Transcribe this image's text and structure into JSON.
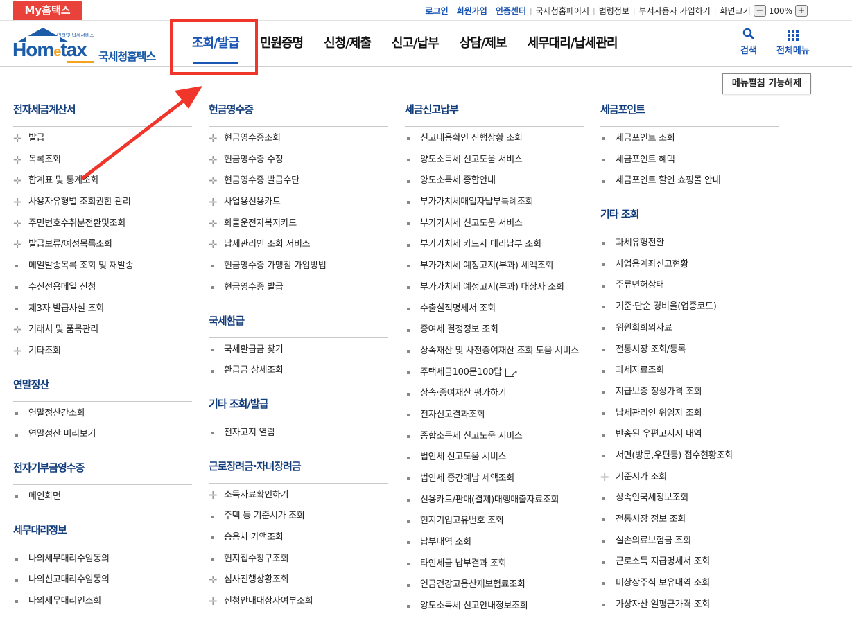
{
  "top": {
    "myhometax": "My홈택스",
    "links": [
      "로그인",
      "회원가입",
      "인증센터"
    ],
    "links2": [
      "국세청홈페이지",
      "법령정보",
      "부서사용자 가입하기",
      "화면크기"
    ],
    "zoom_value": "100%",
    "zoom_minus": "−",
    "zoom_plus": "+"
  },
  "header": {
    "logo_small": "인터넷 납세서비스",
    "logo_home": "Hom",
    "logo_e": "e",
    "logo_tax": "tax",
    "logo_kr": "국세청홈택스",
    "nav": [
      "조회/발급",
      "민원증명",
      "신청/제출",
      "신고/납부",
      "상담/제보",
      "세무대리/납세관리"
    ],
    "search_label": "검색",
    "allmenu_label": "전체메뉴"
  },
  "menu_toggle_label": "메뉴펼침 기능해제",
  "columns": [
    {
      "sections": [
        {
          "title": "전자세금계산서",
          "items": [
            {
              "b": "plus",
              "t": "발급"
            },
            {
              "b": "plus",
              "t": "목록조회"
            },
            {
              "b": "plus",
              "t": "합계표 및 통계조회"
            },
            {
              "b": "plus",
              "t": "사용자유형별 조회권한 관리"
            },
            {
              "b": "plus",
              "t": "주민번호수취분전환및조회"
            },
            {
              "b": "plus",
              "t": "발급보류/예정목록조회"
            },
            {
              "b": "dot",
              "t": "메일발송목록 조회 및 재발송"
            },
            {
              "b": "dot",
              "t": "수신전용메일 신청"
            },
            {
              "b": "dot",
              "t": "제3자 발급사실 조회"
            },
            {
              "b": "plus",
              "t": "거래처 및 품목관리"
            },
            {
              "b": "plus",
              "t": "기타조회"
            }
          ]
        },
        {
          "title": "연말정산",
          "items": [
            {
              "b": "dot",
              "t": "연말정산간소화"
            },
            {
              "b": "dot",
              "t": "연말정산 미리보기"
            }
          ]
        },
        {
          "title": "전자기부금영수증",
          "items": [
            {
              "b": "dot",
              "t": "메인화면"
            }
          ]
        },
        {
          "title": "세무대리정보",
          "items": [
            {
              "b": "dot",
              "t": "나의세무대리수임동의"
            },
            {
              "b": "dot",
              "t": "나의신고대리수임동의"
            },
            {
              "b": "dot",
              "t": "나의세무대리인조회"
            }
          ]
        }
      ]
    },
    {
      "sections": [
        {
          "title": "현금영수증",
          "items": [
            {
              "b": "plus",
              "t": "현금영수증조회"
            },
            {
              "b": "plus",
              "t": "현금영수증 수정"
            },
            {
              "b": "plus",
              "t": "현금영수증 발급수단"
            },
            {
              "b": "plus",
              "t": "사업용신용카드"
            },
            {
              "b": "plus",
              "t": "화물운전자복지카드"
            },
            {
              "b": "plus",
              "t": "납세관리인 조회 서비스"
            },
            {
              "b": "dot",
              "t": "현금영수증 가맹점 가입방법"
            },
            {
              "b": "dot",
              "t": "현금영수증 발급"
            }
          ]
        },
        {
          "title": "국세환급",
          "items": [
            {
              "b": "dot",
              "t": "국세환급금 찾기"
            },
            {
              "b": "dot",
              "t": "환급금 상세조회"
            }
          ]
        },
        {
          "title": "기타 조회/발급",
          "items": [
            {
              "b": "dot",
              "t": "전자고지 열람"
            }
          ]
        },
        {
          "title": "근로장려금·자녀장려금",
          "items": [
            {
              "b": "plus",
              "t": "소득자료확인하기"
            },
            {
              "b": "dot",
              "t": "주택 등 기준시가 조회"
            },
            {
              "b": "dot",
              "t": "승용차 가액조회"
            },
            {
              "b": "dot",
              "t": "현지접수창구조회"
            },
            {
              "b": "plus",
              "t": "심사진행상황조회"
            },
            {
              "b": "plus",
              "t": "신청안내대상자여부조회"
            }
          ]
        }
      ]
    },
    {
      "sections": [
        {
          "title": "세금신고납부",
          "items": [
            {
              "b": "dot",
              "t": "신고내용확인 진행상황 조회"
            },
            {
              "b": "dot",
              "t": "양도소득세 신고도움 서비스"
            },
            {
              "b": "dot",
              "t": "양도소득세 종합안내"
            },
            {
              "b": "dot",
              "t": "부가가치세매입자납부특례조회"
            },
            {
              "b": "dot",
              "t": "부가가치세 신고도움 서비스"
            },
            {
              "b": "dot",
              "t": "부가가치세 카드사 대리납부 조회"
            },
            {
              "b": "dot",
              "t": "부가가치세 예정고지(부과) 세액조회"
            },
            {
              "b": "dot",
              "t": "부가가치세 예정고지(부과) 대상자 조회"
            },
            {
              "b": "dot",
              "t": "수출실적명세서 조회"
            },
            {
              "b": "dot",
              "t": "증여세 결정정보 조회"
            },
            {
              "b": "dot",
              "t": "상속재산 및 사전증여재산 조회 도움 서비스"
            },
            {
              "b": "dot",
              "t": "주택세금100문100답",
              "ext": true
            },
            {
              "b": "dot",
              "t": "상속·증여재산 평가하기"
            },
            {
              "b": "dot",
              "t": "전자신고결과조회"
            },
            {
              "b": "dot",
              "t": "종합소득세 신고도움 서비스"
            },
            {
              "b": "dot",
              "t": "법인세 신고도움 서비스"
            },
            {
              "b": "dot",
              "t": "법인세 중간예납 세액조회"
            },
            {
              "b": "dot",
              "t": "신용카드/판매(결제)대행매출자료조회"
            },
            {
              "b": "dot",
              "t": "현지기업고유번호 조회"
            },
            {
              "b": "dot",
              "t": "납부내역 조회"
            },
            {
              "b": "dot",
              "t": "타인세금 납부결과 조회"
            },
            {
              "b": "dot",
              "t": "연금건강고용산재보험료조회"
            },
            {
              "b": "dot",
              "t": "양도소득세 신고안내정보조회"
            }
          ]
        }
      ]
    },
    {
      "sections": [
        {
          "title": "세금포인트",
          "items": [
            {
              "b": "dot",
              "t": "세금포인트 조회"
            },
            {
              "b": "dot",
              "t": "세금포인트 혜택"
            },
            {
              "b": "dot",
              "t": "세금포인트 할인 쇼핑몰 안내"
            }
          ]
        },
        {
          "title": "기타 조회",
          "items": [
            {
              "b": "dot",
              "t": "과세유형전환"
            },
            {
              "b": "dot",
              "t": "사업용계좌신고현황"
            },
            {
              "b": "dot",
              "t": "주류면허상태"
            },
            {
              "b": "dot",
              "t": "기준·단순 경비율(업종코드)"
            },
            {
              "b": "dot",
              "t": "위원회회의자료"
            },
            {
              "b": "dot",
              "t": "전통시장 조회/등록"
            },
            {
              "b": "dot",
              "t": "과세자료조회"
            },
            {
              "b": "dot",
              "t": "지급보증 정상가격 조회"
            },
            {
              "b": "dot",
              "t": "납세관리인 위임자 조회"
            },
            {
              "b": "dot",
              "t": "반송된 우편고지서 내역"
            },
            {
              "b": "dot",
              "t": "서면(방문,우편등) 접수현황조회"
            },
            {
              "b": "plus",
              "t": "기준시가 조회"
            },
            {
              "b": "dot",
              "t": "상속인국세정보조회"
            },
            {
              "b": "dot",
              "t": "전통시장 정보 조회"
            },
            {
              "b": "dot",
              "t": "실손의료보험금 조회"
            },
            {
              "b": "dot",
              "t": "근로소득 지급명세서 조회"
            },
            {
              "b": "dot",
              "t": "비상장주식 보유내역 조회"
            },
            {
              "b": "dot",
              "t": "가상자산 일평균가격 조회"
            }
          ]
        }
      ]
    }
  ]
}
